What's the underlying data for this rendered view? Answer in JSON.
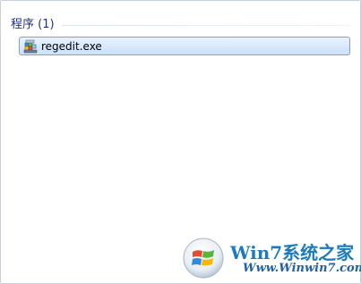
{
  "results": {
    "group_title": "程序 (1)",
    "items": [
      {
        "label": "regedit.exe",
        "icon": "regedit-icon"
      }
    ]
  },
  "watermark": {
    "title": "Win7系统之家",
    "url": "Www.Winwin7.com",
    "logo_icon": "windows-orb-icon"
  },
  "colors": {
    "group_title": "#1e3287",
    "selection_border": "#7da2ce",
    "selection_fill": "#d7e7fb",
    "watermark_blue": "#1b7bbf"
  }
}
